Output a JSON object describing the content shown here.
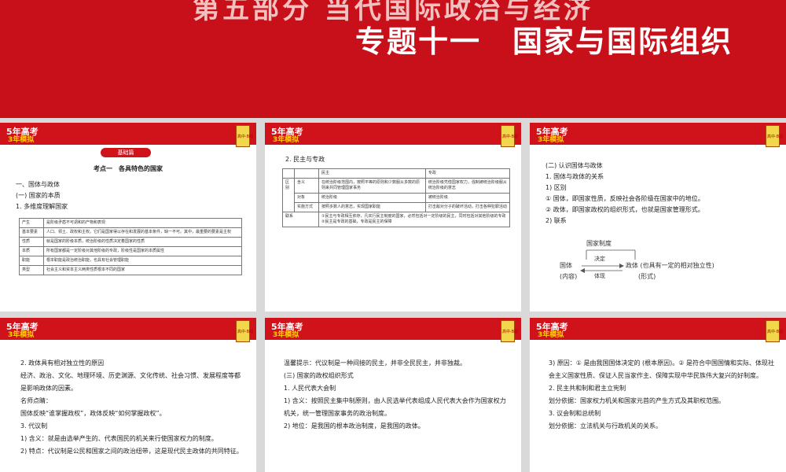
{
  "header": {
    "top_line": "第五部分 当代国际政治与经济",
    "subtitle": "专题十一　国家与国际组织"
  },
  "brand": {
    "logo_line1": "5年高考",
    "logo_line2": "3年模拟",
    "badge": "高中·B版"
  },
  "slide1": {
    "badge": "基础篇",
    "heading": "考点一　各具特色的国家",
    "lines": [
      "一、国体与政体",
      "(一) 国家的本质",
      "1. 多维度理解国家"
    ],
    "table": [
      [
        "产生",
        "是阶级矛盾不可调和的产物和表现"
      ],
      [
        "基本要素",
        "人口、领土、政权和主权。它们是国家得以存在和发展的基本条件，缺一不可。其中，最重要的要素是主权"
      ],
      [
        "性质",
        "就是国家的阶级本质，统治阶级的性质决定着国家的性质"
      ],
      [
        "本质",
        "所有国家都是一定阶级对其他阶级的专政，阶级性是国家的本质属性"
      ],
      [
        "职能",
        "根本职能是政治统治职能，也具有社会管理职能"
      ],
      [
        "类型",
        "社会主义和资本主义两类性质根本不同的国家"
      ]
    ]
  },
  "slide2": {
    "heading": "2. 民主与专政",
    "col_democracy": "民主",
    "col_dictatorship": "专政",
    "group_label": "区别",
    "rows": [
      {
        "label": "含义",
        "democracy": "在统治阶级范围内，按照平等的原则和少数服从多数的原则来共同管理国家事务",
        "dictatorship": "统治阶级凭借国家权力，强制被统治阶级服从统治阶级的意志"
      },
      {
        "label": "对象",
        "democracy": "统治阶级",
        "dictatorship": "被统治阶级"
      },
      {
        "label": "实施方式",
        "democracy": "按照多数人的意志，实现国家职能",
        "dictatorship": "打击敌对分子的破坏活动，打击各种犯罪活动"
      }
    ],
    "link_label": "联系",
    "link_text_1": "①民主与专政相互依存，凡实行民主制度的国家，必然包括对一定阶级的民主，同时包括对其他阶级的专政",
    "link_text_2": "②民主是专政的基础，专政是民主的保障"
  },
  "slide3": {
    "lines": [
      "(二) 认识国体与政体",
      "1. 国体与政体的关系",
      "1) 区别",
      "① 国体，即国家性质，反映社会各阶级在国家中的地位。",
      "② 政体，即国家政权的组织形式，也就是国家管理形式。",
      "2) 联系"
    ],
    "diagram": {
      "top": "国家制度",
      "left": "国体",
      "left_sub": "(内容)",
      "arrow_top": "决定",
      "arrow_bottom": "体现",
      "right": "政体 (也具有一定的相对独立性)",
      "right_sub": "(形式)"
    }
  },
  "slide4": {
    "lines": [
      "2. 政体具有相对独立性的原因",
      "经济、政治、文化、地理环境、历史渊源、文化传统、社会习惯、发展程度等都是影响政体的因素。",
      "名师点睛：",
      "国体反映“谁掌握政权”，政体反映“如何掌握政权”。",
      "3. 代议制",
      "1) 含义：就是由选举产生的、代表国民的机关来行使国家权力的制度。",
      "2) 特点：代议制是公民和国家之间的政治纽带，这是现代民主政体的共同特征。"
    ]
  },
  "slide5": {
    "lines": [
      "温馨提示：代议制是一种间接的民主，并非全民民主，并非独裁。",
      "(三) 国家的政权组织形式",
      "1. 人民代表大会制",
      "1) 含义：按照民主集中制原则，由人民选举代表组成人民代表大会作为国家权力机关，统一管理国家事务的政治制度。",
      "2) 地位：是我国的根本政治制度，是我国的政体。"
    ]
  },
  "slide6": {
    "lines": [
      "3) 原因：① 是由我国国体决定的 (根本原因)。② 是符合中国国情和实际、体现社会主义国家性质、保证人民当家作主、保障实现中华民族伟大复兴的好制度。",
      "2. 民主共和制和君主立宪制",
      "划分依据：国家权力机关和国家元首的产生方式及其职权范围。",
      "3. 议会制和总统制",
      "划分依据：立法机关与行政机关的关系。"
    ]
  }
}
